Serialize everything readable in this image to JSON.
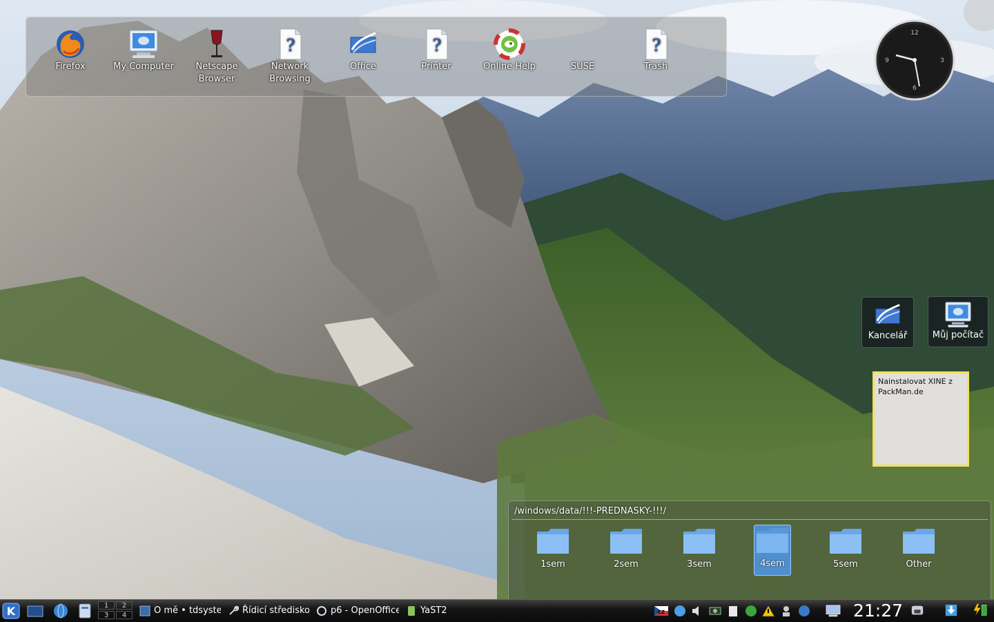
{
  "desktop_icons": [
    {
      "label": "Firefox",
      "icon": "firefox-icon"
    },
    {
      "label": "My Computer",
      "icon": "computer-icon"
    },
    {
      "label": "Netscape Browser",
      "icon": "wine-glass-icon"
    },
    {
      "label": "Network Browsing",
      "icon": "unknown-file-icon"
    },
    {
      "label": "Office",
      "icon": "office-icon"
    },
    {
      "label": "Printer",
      "icon": "unknown-file-icon"
    },
    {
      "label": "Online Help",
      "icon": "help-lifebuoy-icon"
    },
    {
      "label": "SUSE",
      "icon": "suse-icon"
    },
    {
      "label": "Trash",
      "icon": "unknown-file-icon"
    }
  ],
  "right_icons": [
    {
      "label": "Kancelář",
      "icon": "office-icon"
    },
    {
      "label": "Můj počítač",
      "icon": "computer-icon"
    }
  ],
  "note": {
    "text": "Nainstalovat XINE z PackMan.de"
  },
  "folderview": {
    "path": "/windows/data/!!!-PREDNASKY-!!!/",
    "folders": [
      "1sem",
      "2sem",
      "3sem",
      "4sem",
      "5sem",
      "Other"
    ],
    "selected": "4sem"
  },
  "clock": {
    "numbers": [
      "12",
      "3",
      "6",
      "9"
    ]
  },
  "taskbar": {
    "pager": [
      "1",
      "2",
      "3",
      "4"
    ],
    "tasks": [
      {
        "label": "O mě • tdsyste",
        "icon": "konqueror-icon"
      },
      {
        "label": "Řídicí středisko",
        "icon": "wrench-icon"
      },
      {
        "label": "p6 - OpenOffice",
        "icon": "openoffice-icon"
      },
      {
        "label": "YaST2",
        "icon": "yast-icon"
      }
    ],
    "keyboard_layout": "CZ",
    "time": "21:27"
  },
  "colors": {
    "accent": "#4a90d9",
    "note_border": "#f3e05c",
    "taskbar": "#111111"
  }
}
